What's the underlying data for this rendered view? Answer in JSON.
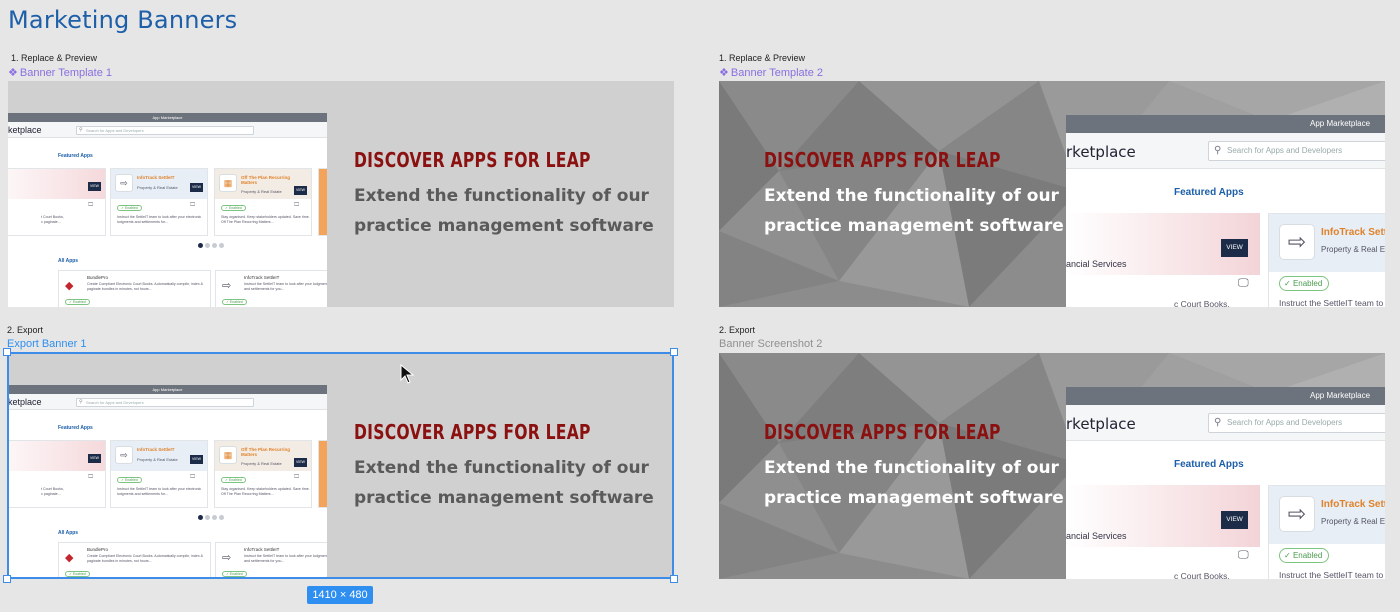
{
  "page_title": "Marketing Banners",
  "sections": {
    "replace_label": "1. Replace & Preview",
    "export_label": "2. Export"
  },
  "frames": {
    "template1": "Banner Template 1",
    "template2": "Banner Template 2",
    "export1": "Export Banner 1",
    "screenshot2": "Banner Screenshot 2"
  },
  "banner": {
    "headline": "DISCOVER APPS FOR LEAP",
    "sub1": "Extend the functionality of our",
    "sub2": "practice management software"
  },
  "marketplace": {
    "bar_title": "App Marketplace",
    "brand": "ketplace",
    "brand_large": "rketplace",
    "search_placeholder": "Search for Apps and Developers",
    "featured": "Featured Apps",
    "all_apps": "All Apps",
    "side_financial": "ial Services",
    "side_financial_large": "ancial Services",
    "side_e": "e",
    "view": "VIEW",
    "enabled": "Enabled",
    "court_books": "t Court Books,",
    "court_books_large": "c Court Books,",
    "paginate": "c paginate...",
    "infotrack_title": "InfoTrack SettleIT",
    "infotrack_title_large": "InfoTrack Settl",
    "property": "Property & Real Estate",
    "property_large": "Property & Real Es",
    "infotrack_desc": "Instruct the SettleIT team to look after your electronic lodgments and settlements for...",
    "infotrack_desc_large": "Instruct the SettleIT team to lo",
    "otp_title": "Off The Plan Recurring Matters",
    "otp_desc": "Stay organised. Keep stakeholders updated. Save time. Off The Plan Recurring Matters...",
    "bundlepro_title": "BundlePro",
    "bundlepro_desc": "Create Compliant Electronic Court Books. Automatically compile, index & paginate bundles in minutes, not hours...",
    "infotrack_all_title": "InfoTrack SettleIT",
    "infotrack_all_desc": "Instruct the SettleIT team to look after your lodgments and settlements for you..."
  },
  "size_badge": "1410 × 480",
  "colors": {
    "title_blue": "#1d5fa8",
    "component_purple": "#8a6fe0",
    "selection_blue": "#3d8de8",
    "headline_red": "#8b1010"
  }
}
